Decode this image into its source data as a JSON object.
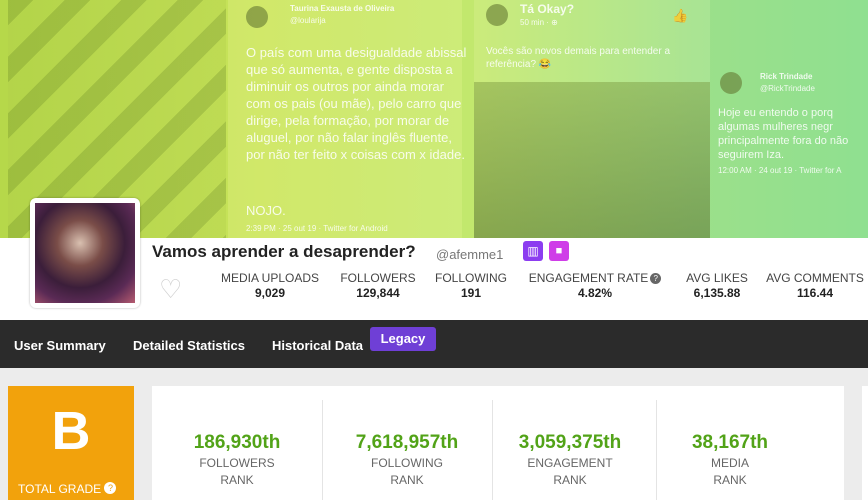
{
  "banner": {
    "tweet1": {
      "author": "Taurina Exausta de Oliveira",
      "handle": "@loularija",
      "body": "O país com uma desigualdade abissal que só aumenta, e gente disposta a diminuir os outros por ainda morar com os pais (ou mãe), pelo carro que dirige, pela formação, por morar de aluguel, por não falar inglês fluente, por não ter feito x coisas com x idade.",
      "footer_word": "NOJO.",
      "meta": "2:39 PM · 25 out 19 · Twitter for Android"
    },
    "tweet2": {
      "author": "Tá Okay?",
      "handle": "50 min · ⊕",
      "body": "Vocês são novos demais para entender a referência? 😂"
    },
    "tweet3": {
      "author": "Rick Trindade",
      "handle": "@RickTrindade",
      "body": "Hoje eu entendo o porq algumas mulheres negr principalmente fora do não seguirem Iza.",
      "meta": "12:00 AM · 24 out 19 · Twitter for A"
    }
  },
  "profile": {
    "name": "Vamos aprender a desaprender?",
    "handle": "@afemme1",
    "stats": [
      {
        "label": "MEDIA UPLOADS",
        "value": "9,029"
      },
      {
        "label": "FOLLOWERS",
        "value": "129,844"
      },
      {
        "label": "FOLLOWING",
        "value": "191"
      },
      {
        "label": "ENGAGEMENT RATE",
        "value": "4.82%"
      },
      {
        "label": "AVG LIKES",
        "value": "6,135.88"
      },
      {
        "label": "AVG COMMENTS",
        "value": "116.44"
      }
    ]
  },
  "nav": {
    "items": [
      "User Summary",
      "Detailed Statistics",
      "Historical Data",
      "Legacy"
    ]
  },
  "grade": {
    "letter": "B",
    "label": "TOTAL GRADE"
  },
  "ranks": [
    {
      "value": "186,930th",
      "line1": "FOLLOWERS",
      "line2": "RANK"
    },
    {
      "value": "7,618,957th",
      "line1": "FOLLOWING",
      "line2": "RANK"
    },
    {
      "value": "3,059,375th",
      "line1": "ENGAGEMENT",
      "line2": "RANK"
    },
    {
      "value": "38,167th",
      "line1": "MEDIA",
      "line2": "RANK"
    }
  ],
  "colors": {
    "grade": "#f2a20c",
    "rank_value": "#52a318",
    "legacy": "#6f3fd6",
    "nav_bg": "#2b2b2b"
  }
}
